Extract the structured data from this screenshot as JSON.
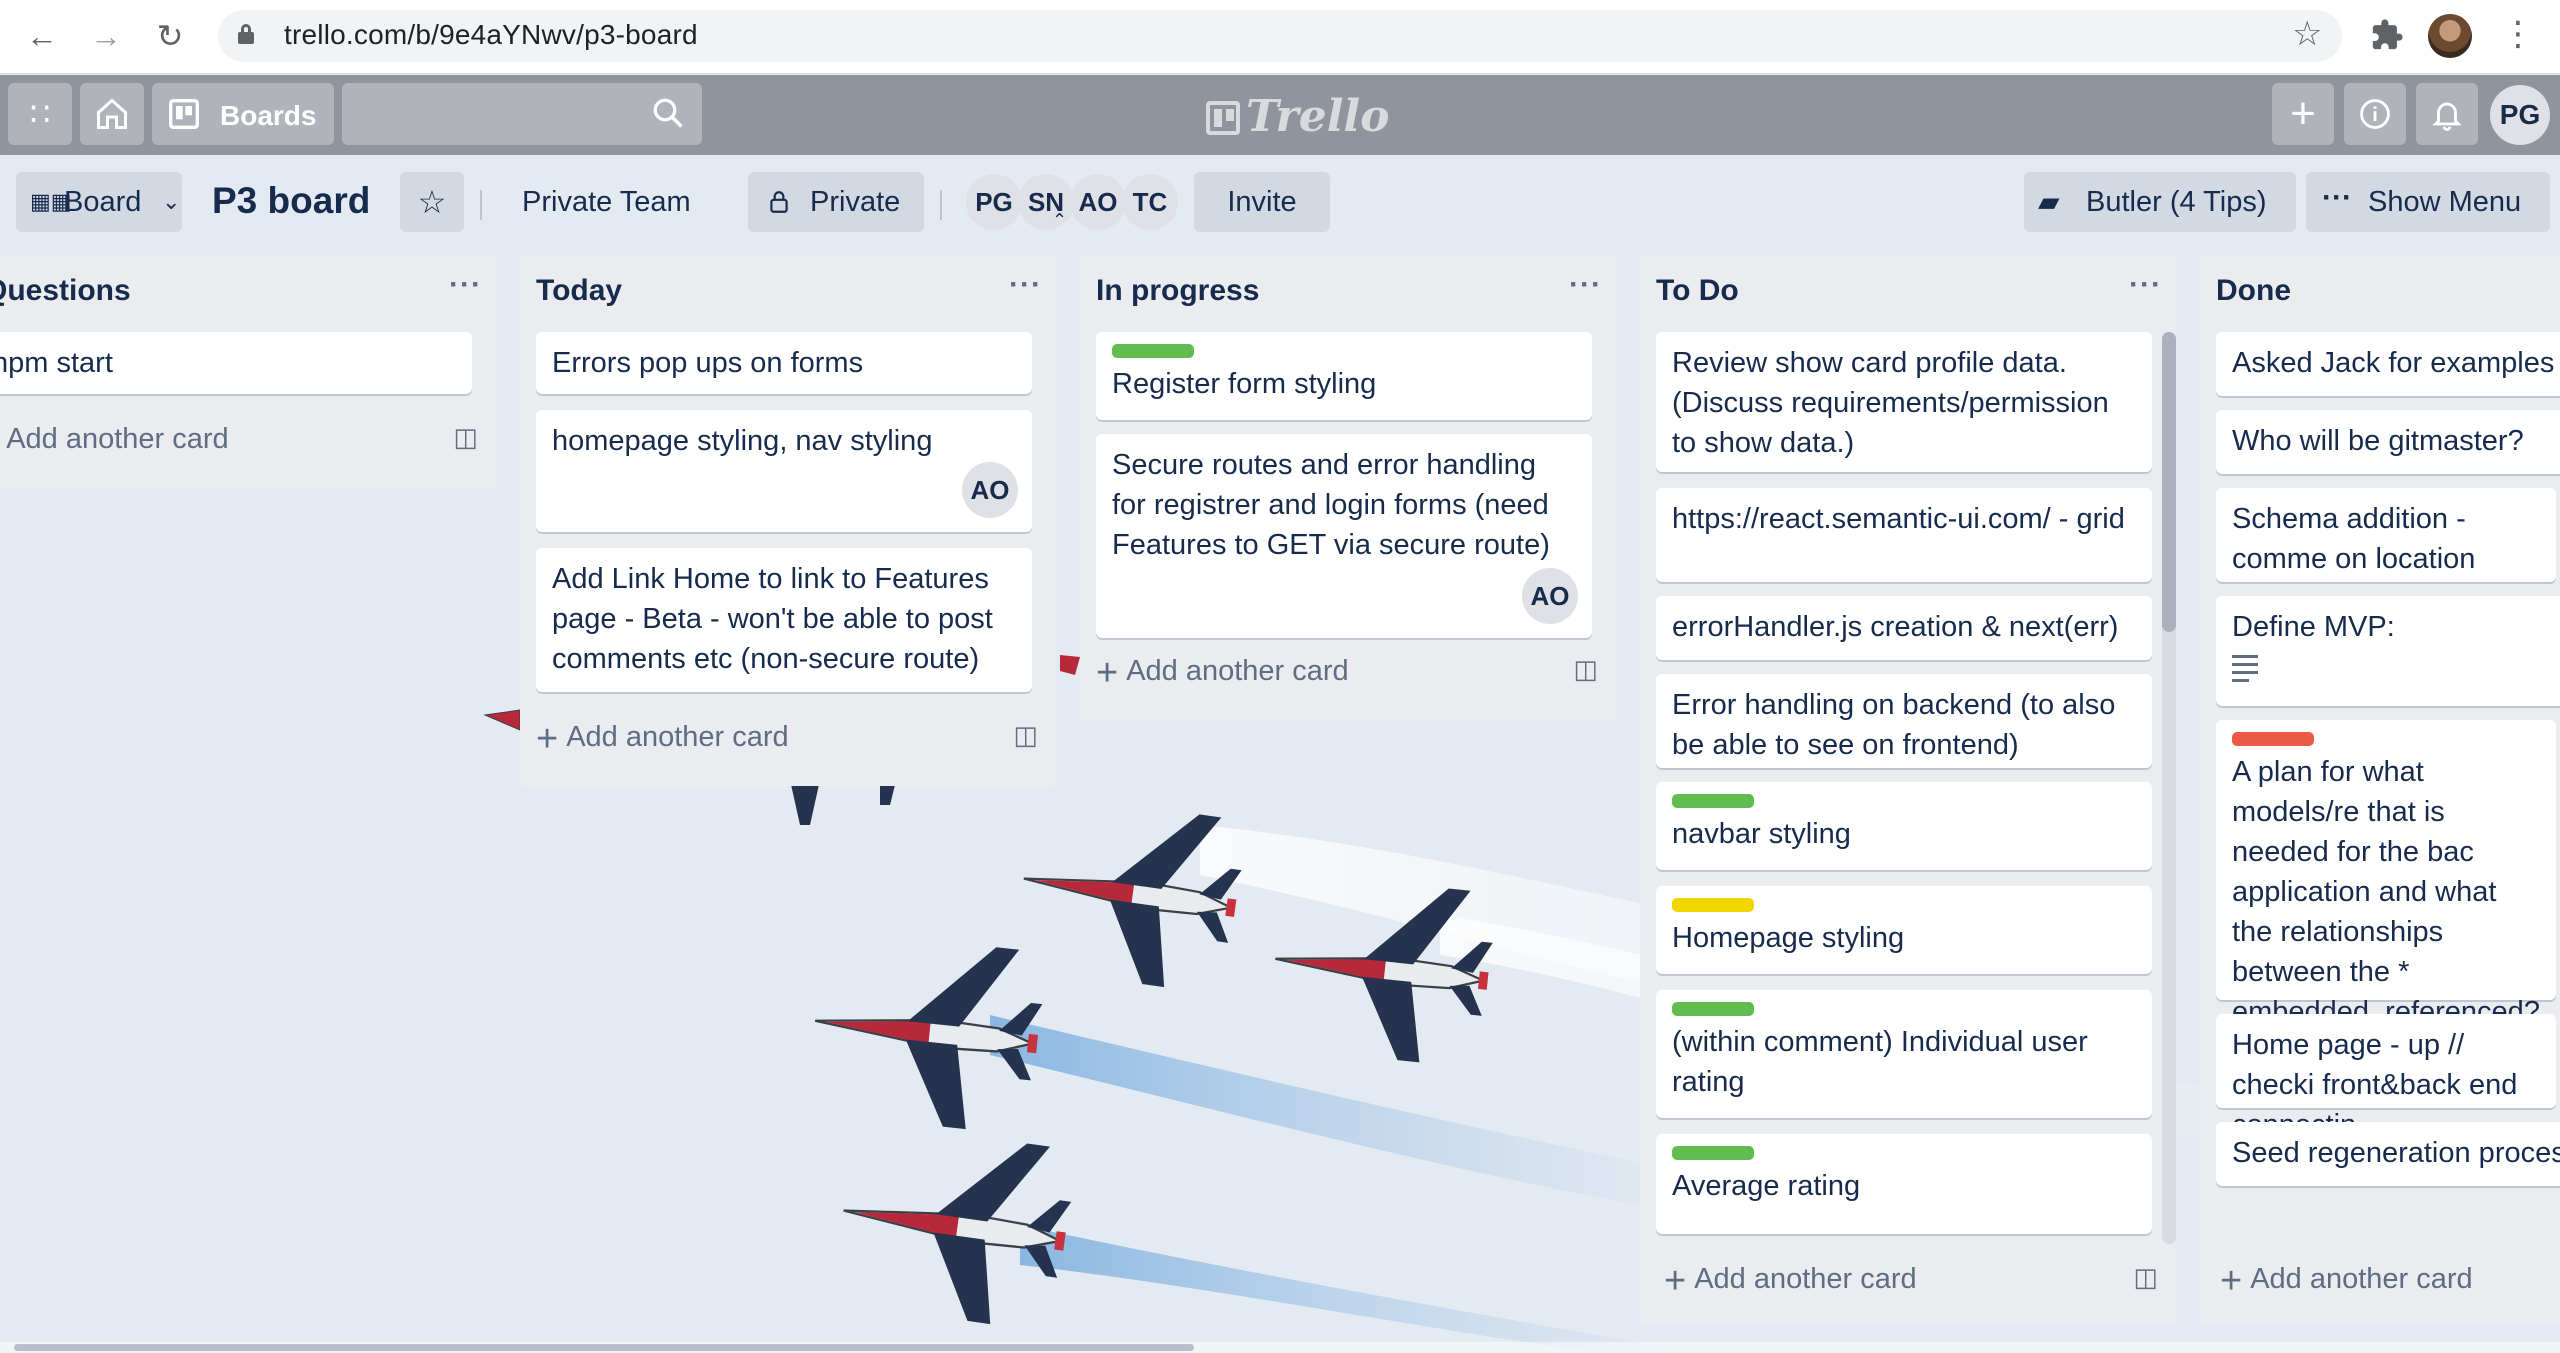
{
  "browser": {
    "url": "trello.com/b/9e4aYNwv/p3-board"
  },
  "header": {
    "boards_label": "Boards",
    "logo_text": "Trello",
    "user_initials": "PG"
  },
  "board": {
    "view_label": "Board",
    "title": "P3 board",
    "team_label": "Private Team",
    "visibility_label": "Private",
    "members": [
      "PG",
      "SN",
      "AO",
      "TC"
    ],
    "invite_label": "Invite",
    "butler_label": "Butler (4 Tips)",
    "menu_label": "Show Menu"
  },
  "lists": [
    {
      "title": "Questions",
      "cards": [
        {
          "text": "npm start"
        }
      ],
      "add_label": "Add another card"
    },
    {
      "title": "Today",
      "cards": [
        {
          "text": "Errors pop ups on forms"
        },
        {
          "text": "homepage styling, nav styling",
          "member": "AO"
        },
        {
          "text": "Add Link Home to link to Features page - Beta - won't be able to post comments etc (non-secure route)"
        }
      ],
      "add_label": "Add another card"
    },
    {
      "title": "In progress",
      "cards": [
        {
          "text": "Register form styling",
          "label_color": "#61bd4f"
        },
        {
          "text": "Secure routes and error handling for registrer and login forms (need Features to GET via secure route)",
          "member": "AO"
        }
      ],
      "add_label": "Add another card"
    },
    {
      "title": "To Do",
      "cards": [
        {
          "text": "Review show card profile data. (Discuss requirements/permission to show data.)"
        },
        {
          "text": "https://react.semantic-ui.com/ - grid"
        },
        {
          "text": "errorHandler.js creation & next(err)"
        },
        {
          "text": "Error handling on backend (to also be able to see on frontend)"
        },
        {
          "text": "navbar styling",
          "label_color": "#61bd4f"
        },
        {
          "text": "Homepage styling",
          "label_color": "#f2d600"
        },
        {
          "text": "(within comment) Individual user rating",
          "label_color": "#61bd4f"
        },
        {
          "text": "Average rating",
          "label_color": "#61bd4f"
        }
      ],
      "add_label": "Add another card"
    },
    {
      "title": "Done",
      "cards": [
        {
          "text": "Asked Jack for examples"
        },
        {
          "text": "Who will be gitmaster?"
        },
        {
          "text": "Schema addition - comme on location"
        },
        {
          "text": "Define MVP:"
        },
        {
          "text": "A plan for what models/re that is needed for the bac application and what the relationships between the * embedded, referenced? many",
          "label_color": "#eb5a46"
        },
        {
          "text": "Home page - up // checki front&back end connectin"
        },
        {
          "text": "Seed regeneration proces"
        }
      ],
      "add_label": "Add another card"
    }
  ],
  "colors": {
    "label_green": "#61bd4f",
    "label_yellow": "#f2d600",
    "label_red": "#eb5a46",
    "header_bg": "#6e737d",
    "list_bg": "#ebecf0"
  }
}
